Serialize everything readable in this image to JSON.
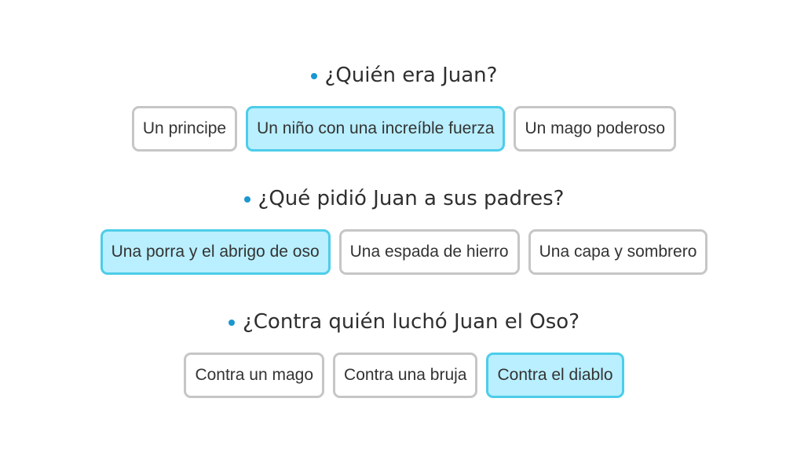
{
  "colors": {
    "bullet": "#1a97d0",
    "selected_background": "#b9efff",
    "selected_border": "#4dcde9",
    "unselected_border": "#c6c6c6"
  },
  "questions": [
    {
      "text": "¿Quién era Juan?",
      "options": [
        {
          "label": "Un principe",
          "selected": false
        },
        {
          "label": "Un niño con una increíble fuerza",
          "selected": true
        },
        {
          "label": "Un mago poderoso",
          "selected": false
        }
      ]
    },
    {
      "text": "¿Qué pidió Juan a sus padres?",
      "options": [
        {
          "label": "Una porra y el abrigo de oso",
          "selected": true
        },
        {
          "label": "Una espada de hierro",
          "selected": false
        },
        {
          "label": "Una capa y sombrero",
          "selected": false
        }
      ]
    },
    {
      "text": "¿Contra quién luchó Juan el Oso?",
      "options": [
        {
          "label": "Contra un mago",
          "selected": false
        },
        {
          "label": "Contra una bruja",
          "selected": false
        },
        {
          "label": "Contra el diablo",
          "selected": true
        }
      ]
    }
  ]
}
